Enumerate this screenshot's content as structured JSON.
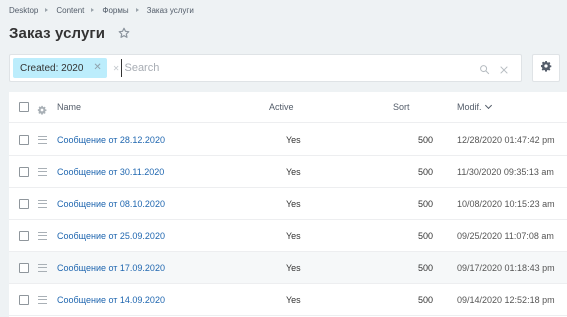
{
  "breadcrumb": [
    "Desktop",
    "Content",
    "Формы",
    "Заказ услуги"
  ],
  "page_title": "Заказ услуги",
  "search": {
    "filter_chip": "Created: 2020",
    "placeholder": "Search"
  },
  "table": {
    "headers": {
      "name": "Name",
      "active": "Active",
      "sort": "Sort",
      "modified": "Modif."
    },
    "rows": [
      {
        "name": "Сообщение от 28.12.2020",
        "active": "Yes",
        "sort": "500",
        "modified": "12/28/2020 01:47:42 pm"
      },
      {
        "name": "Сообщение от 30.11.2020",
        "active": "Yes",
        "sort": "500",
        "modified": "11/30/2020 09:35:13 am"
      },
      {
        "name": "Сообщение от 08.10.2020",
        "active": "Yes",
        "sort": "500",
        "modified": "10/08/2020 10:15:23 am"
      },
      {
        "name": "Сообщение от 25.09.2020",
        "active": "Yes",
        "sort": "500",
        "modified": "09/25/2020 11:07:08 am"
      },
      {
        "name": "Сообщение от 17.09.2020",
        "active": "Yes",
        "sort": "500",
        "modified": "09/17/2020 01:18:43 pm"
      },
      {
        "name": "Сообщение от 14.09.2020",
        "active": "Yes",
        "sort": "500",
        "modified": "09/14/2020 12:52:18 pm"
      }
    ]
  },
  "icons": {
    "favorite": "star-icon",
    "search": "search-icon",
    "clear": "close-icon",
    "settings": "gear-icon",
    "drag": "drag-handle-icon"
  },
  "colors": {
    "link": "#2067b0",
    "chip_bg": "#bcedfc",
    "page_bg": "#eef2f4"
  }
}
